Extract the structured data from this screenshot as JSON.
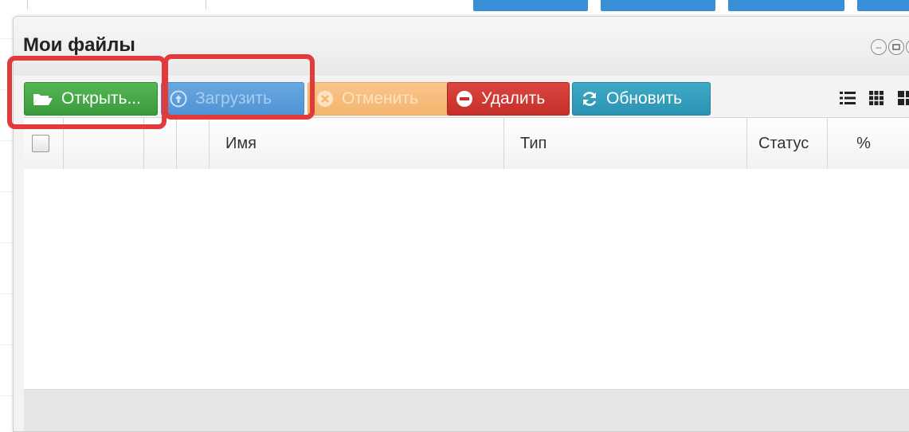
{
  "window": {
    "title": "Мои файлы"
  },
  "toolbar": {
    "open_label": "Открыть...",
    "upload_label": "Загрузить",
    "cancel_label": "Отменить",
    "delete_label": "Удалить",
    "refresh_label": "Обновить"
  },
  "grid": {
    "columns": [
      "Имя",
      "Тип",
      "Статус",
      "%"
    ]
  },
  "colors": {
    "open": "#47a447",
    "upload": "#5a9fdc",
    "cancel": "#f6bc7a",
    "delete": "#d2322d",
    "refresh": "#39a3c1",
    "highlight": "#e23a3a"
  },
  "icons": {
    "open": "folder-open-icon",
    "upload": "upload-circle-icon",
    "cancel": "cancel-circle-icon",
    "delete": "minus-circle-icon",
    "refresh": "refresh-icon",
    "view_list": "list-view-icon",
    "view_grid": "grid-view-icon",
    "view_tiles": "tiles-view-icon"
  }
}
